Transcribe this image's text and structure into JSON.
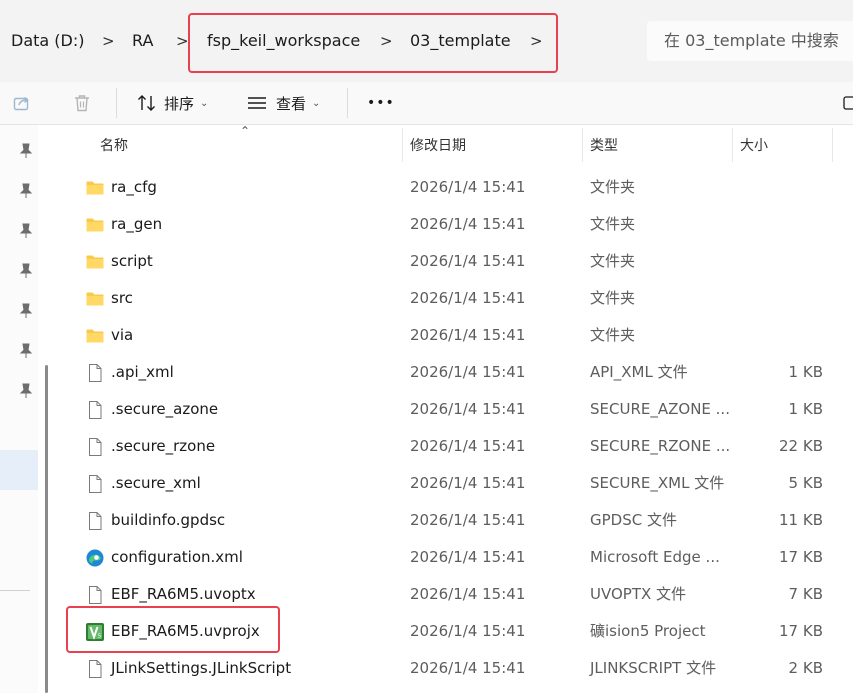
{
  "breadcrumbs": [
    {
      "label": "Data (D:)"
    },
    {
      "label": "RA"
    },
    {
      "label": "fsp_keil_workspace"
    },
    {
      "label": "03_template"
    }
  ],
  "search": {
    "placeholder": "在 03_template 中搜索"
  },
  "toolbar": {
    "sort_label": "排序",
    "view_label": "查看",
    "more_label": "•••"
  },
  "columns": {
    "name": "名称",
    "date": "修改日期",
    "type": "类型",
    "size": "大小"
  },
  "files": [
    {
      "name": "ra_cfg",
      "date": "2026/1/4 15:41",
      "type": "文件夹",
      "size": "",
      "icon": "folder-icon"
    },
    {
      "name": "ra_gen",
      "date": "2026/1/4 15:41",
      "type": "文件夹",
      "size": "",
      "icon": "folder-icon"
    },
    {
      "name": "script",
      "date": "2026/1/4 15:41",
      "type": "文件夹",
      "size": "",
      "icon": "folder-icon"
    },
    {
      "name": "src",
      "date": "2026/1/4 15:41",
      "type": "文件夹",
      "size": "",
      "icon": "folder-icon"
    },
    {
      "name": "via",
      "date": "2026/1/4 15:41",
      "type": "文件夹",
      "size": "",
      "icon": "folder-icon"
    },
    {
      "name": ".api_xml",
      "date": "2026/1/4 15:41",
      "type": "API_XML 文件",
      "size": "1 KB",
      "icon": "file-icon"
    },
    {
      "name": ".secure_azone",
      "date": "2026/1/4 15:41",
      "type": "SECURE_AZONE ...",
      "size": "1 KB",
      "icon": "file-icon"
    },
    {
      "name": ".secure_rzone",
      "date": "2026/1/4 15:41",
      "type": "SECURE_RZONE ...",
      "size": "22 KB",
      "icon": "file-icon"
    },
    {
      "name": ".secure_xml",
      "date": "2026/1/4 15:41",
      "type": "SECURE_XML 文件",
      "size": "5 KB",
      "icon": "file-icon"
    },
    {
      "name": "buildinfo.gpdsc",
      "date": "2026/1/4 15:41",
      "type": "GPDSC 文件",
      "size": "11 KB",
      "icon": "file-icon"
    },
    {
      "name": "configuration.xml",
      "date": "2026/1/4 15:41",
      "type": "Microsoft Edge ...",
      "size": "17 KB",
      "icon": "edge-icon"
    },
    {
      "name": "EBF_RA6M5.uvoptx",
      "date": "2026/1/4 15:41",
      "type": "UVOPTX 文件",
      "size": "7 KB",
      "icon": "file-icon"
    },
    {
      "name": "EBF_RA6M5.uvprojx",
      "date": "2026/1/4 15:41",
      "type": "礦ision5 Project",
      "size": "17 KB",
      "icon": "keil-uvision-icon"
    },
    {
      "name": "JLinkSettings.JLinkScript",
      "date": "2026/1/4 15:41",
      "type": "JLINKSCRIPT 文件",
      "size": "2 KB",
      "icon": "file-icon"
    }
  ],
  "colors": {
    "highlight": "#e8414f",
    "folder": "#f8c94b",
    "keil_green": "#2e7d32"
  }
}
